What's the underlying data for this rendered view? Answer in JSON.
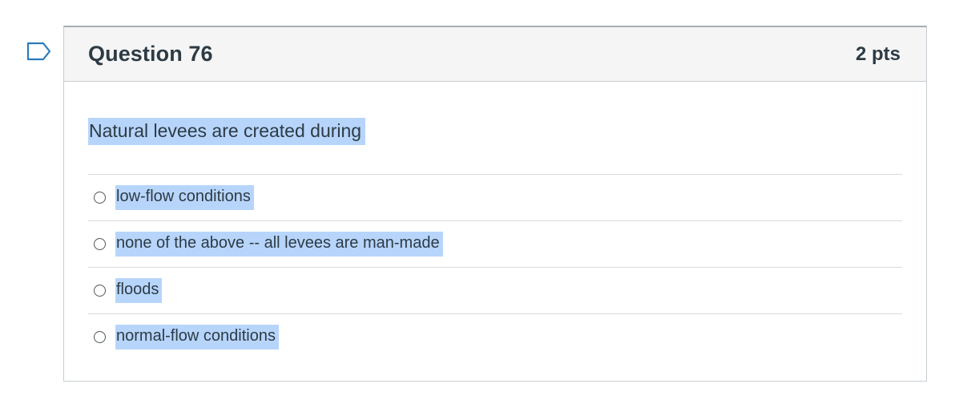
{
  "question": {
    "title": "Question 76",
    "points": "2 pts",
    "text": "Natural levees are created during",
    "answers": [
      {
        "label": "low-flow conditions",
        "selected": false
      },
      {
        "label": "none of the above -- all levees are man-made",
        "selected": false
      },
      {
        "label": "floods",
        "selected": false
      },
      {
        "label": "normal-flow conditions",
        "selected": false
      }
    ]
  },
  "icons": {
    "flag": "flag-question-icon"
  },
  "colors": {
    "selection_highlight": "#b7d5fb",
    "header_background": "#f5f5f5",
    "text": "#2d3b45",
    "border": "#c7cdd1",
    "flag_stroke": "#2b7abc"
  }
}
